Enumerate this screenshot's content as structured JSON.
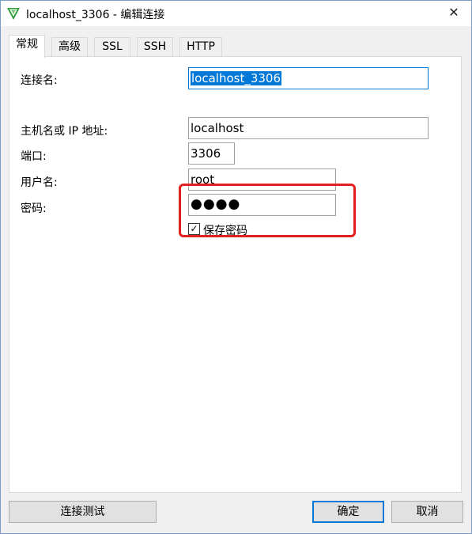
{
  "window": {
    "title": "localhost_3306 - 编辑连接",
    "close_glyph": "✕",
    "app_icon": "navicat-leaf-icon"
  },
  "tabs": [
    {
      "label": "常规",
      "active": true
    },
    {
      "label": "高级",
      "active": false
    },
    {
      "label": "SSL",
      "active": false
    },
    {
      "label": "SSH",
      "active": false
    },
    {
      "label": "HTTP",
      "active": false
    }
  ],
  "form": {
    "connection_name": {
      "label": "连接名:",
      "value": "localhost_3306"
    },
    "host": {
      "label": "主机名或 IP 地址:",
      "value": "localhost"
    },
    "port": {
      "label": "端口:",
      "value": "3306"
    },
    "username": {
      "label": "用户名:",
      "value": "root"
    },
    "password": {
      "label": "密码:",
      "masked_value": "●●●●"
    },
    "save_password": {
      "label": "保存密码",
      "checked": true,
      "check_glyph": "✓"
    }
  },
  "buttons": {
    "test": "连接测试",
    "ok": "确定",
    "cancel": "取消"
  },
  "colors": {
    "selection": "#0078d7",
    "highlight": "#e32020",
    "accent_green": "#2e9c3a"
  }
}
